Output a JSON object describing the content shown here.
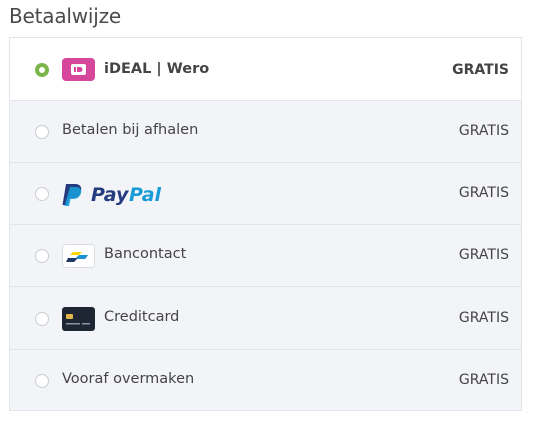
{
  "section": {
    "title": "Betaalwijze"
  },
  "payment_methods": [
    {
      "label": "iDEAL | Wero",
      "price": "GRATIS",
      "selected": true,
      "icon": "ideal-wero-icon"
    },
    {
      "label": "Betalen bij afhalen",
      "price": "GRATIS",
      "selected": false,
      "icon": null
    },
    {
      "label": "PayPal",
      "price": "GRATIS",
      "selected": false,
      "icon": "paypal-logo"
    },
    {
      "label": "Bancontact",
      "price": "GRATIS",
      "selected": false,
      "icon": "bancontact-icon"
    },
    {
      "label": "Creditcard",
      "price": "GRATIS",
      "selected": false,
      "icon": "creditcard-icon"
    },
    {
      "label": "Vooraf overmaken",
      "price": "GRATIS",
      "selected": false,
      "icon": null
    }
  ],
  "colors": {
    "selected_radio": "#7ab648",
    "ideal_pink": "#d6479c",
    "paypal_dark": "#253b80",
    "paypal_light": "#179bd7",
    "bancontact_blue": "#1e3764",
    "bancontact_yellow": "#ffd800"
  }
}
